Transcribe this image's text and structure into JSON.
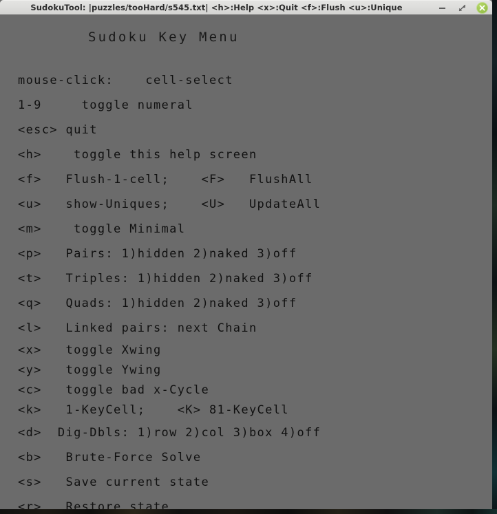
{
  "window": {
    "title": "SudokuTool: |puzzles/tooHard/s545.txt|  <h>:Help  <x>:Quit  <f>:Flush  <u>:Unique",
    "controls": {
      "minimize_label": "minimize",
      "maximize_label": "restore",
      "close_label": "close"
    },
    "colors": {
      "titlebar_bg": "#dcdcda",
      "body_bg": "#6b6b6b",
      "text": "#111111",
      "close_button": "#9cc44e"
    }
  },
  "help": {
    "heading": "Sudoku Key Menu",
    "lines": [
      {
        "id": "mouse-click",
        "text": "mouse-click:    cell-select",
        "tight": false
      },
      {
        "id": "digits-1-9",
        "text": "1-9     toggle numeral",
        "tight": false
      },
      {
        "id": "esc",
        "text": "<esc> quit",
        "tight": false
      },
      {
        "id": "h",
        "text": "<h>    toggle this help screen",
        "tight": false
      },
      {
        "id": "f",
        "text": "<f>   Flush-1-cell;    <F>   FlushAll",
        "tight": false
      },
      {
        "id": "u",
        "text": "<u>   show-Uniques;    <U>   UpdateAll",
        "tight": false
      },
      {
        "id": "m",
        "text": "<m>    toggle Minimal",
        "tight": false
      },
      {
        "id": "p",
        "text": "<p>   Pairs: 1)hidden 2)naked 3)off",
        "tight": false
      },
      {
        "id": "t",
        "text": "<t>   Triples: 1)hidden 2)naked 3)off",
        "tight": false
      },
      {
        "id": "q",
        "text": "<q>   Quads: 1)hidden 2)naked 3)off",
        "tight": false
      },
      {
        "id": "l",
        "text": "<l>   Linked pairs: next Chain",
        "tight": false
      },
      {
        "id": "x",
        "text": "<x>   toggle Xwing",
        "tight": true
      },
      {
        "id": "y",
        "text": "<y>   toggle Ywing",
        "tight": true
      },
      {
        "id": "c",
        "text": "<c>   toggle bad x-Cycle",
        "tight": true
      },
      {
        "id": "k",
        "text": "<k>   1-KeyCell;    <K> 81-KeyCell",
        "tight": true
      },
      {
        "id": "d",
        "text": "<d>  Dig-Dbls: 1)row 2)col 3)box 4)off",
        "tight": false
      },
      {
        "id": "b",
        "text": "<b>   Brute-Force Solve",
        "tight": false
      },
      {
        "id": "s",
        "text": "<s>   Save current state",
        "tight": false
      },
      {
        "id": "r",
        "text": "<r>   Restore state",
        "tight": false
      }
    ]
  }
}
